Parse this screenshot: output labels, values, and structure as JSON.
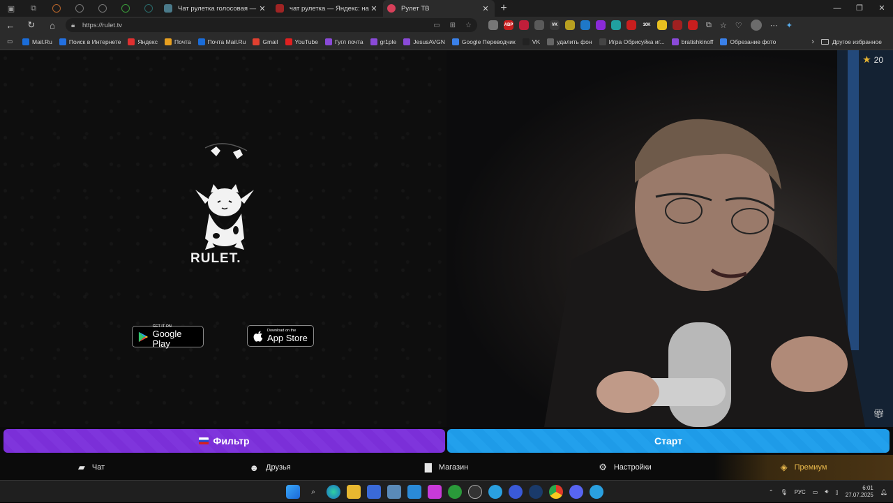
{
  "browser": {
    "tabs": [
      {
        "title": "Чат рулетка голосовая — Nekto",
        "color": "#4a7a8a",
        "active": false
      },
      {
        "title": "чат рулетка — Яндекс: нашлось",
        "color": "#a02424",
        "active": false
      },
      {
        "title": "Рулет ТВ",
        "color": "#d8405a",
        "active": true
      }
    ],
    "close_glyph": "✕",
    "newtab_glyph": "+",
    "url": "https://rulet.tv",
    "bookmarks": [
      {
        "label": "Mail.Ru",
        "color": "#1a6cd8"
      },
      {
        "label": "Поиск в Интернете",
        "color": "#2370e0"
      },
      {
        "label": "Яндекс",
        "color": "#e03030"
      },
      {
        "label": "Почта",
        "color": "#e8a020"
      },
      {
        "label": "Почта Mail.Ru",
        "color": "#1a6cd8"
      },
      {
        "label": "Gmail",
        "color": "#e04030"
      },
      {
        "label": "YouTube",
        "color": "#e02020"
      },
      {
        "label": "Гугл почта",
        "color": "#8a4ad8"
      },
      {
        "label": "gr1ple",
        "color": "#8a4ad8"
      },
      {
        "label": "JesusAVGN",
        "color": "#8a4ad8"
      },
      {
        "label": "Google Переводчик",
        "color": "#3a80e8"
      },
      {
        "label": "VK",
        "color": "#222222"
      },
      {
        "label": "удалить фон",
        "color": "#666666"
      },
      {
        "label": "Игра Обрисуйка иг...",
        "color": "#444444"
      },
      {
        "label": "bratishkinoff",
        "color": "#8a4ad8"
      },
      {
        "label": "Обрезание фото",
        "color": "#3a80e8"
      }
    ],
    "other_bookmarks": "Другое избранное",
    "extensions": [
      {
        "label": "",
        "color": "#777777"
      },
      {
        "label": "ABP",
        "color": "#c81e1e"
      },
      {
        "label": "",
        "color": "#c01e3a"
      },
      {
        "label": "",
        "color": "#5a5a5a"
      },
      {
        "label": "VK",
        "color": "#3a3a3a"
      },
      {
        "label": "",
        "color": "#b8a020"
      },
      {
        "label": "",
        "color": "#1e78c8"
      },
      {
        "label": "",
        "color": "#8a2ad8"
      },
      {
        "label": "",
        "color": "#20a0a0"
      },
      {
        "label": "",
        "color": "#c81e1e"
      },
      {
        "label": "10K",
        "color": "#2a2a2a"
      },
      {
        "label": "",
        "color": "#e8c020"
      },
      {
        "label": "",
        "color": "#a02020"
      },
      {
        "label": "",
        "color": "#c81e1e"
      }
    ]
  },
  "site": {
    "logo_text": "RULET.",
    "google_play": {
      "small": "GET IT ON",
      "big": "Google Play"
    },
    "app_store": {
      "small": "Download on the",
      "big": "App Store"
    },
    "stars_count": "20",
    "filter_label": "Фильтр",
    "start_label": "Старт",
    "menu": {
      "chat": "Чат",
      "friends": "Друзья",
      "shop": "Магазин",
      "settings": "Настройки",
      "premium": "Премиум"
    }
  },
  "taskbar": {
    "language": "РУС",
    "time": "6:01",
    "date": "27.07.2025"
  },
  "colors": {
    "filter_bar": "#7b2fd8",
    "start_bar": "#1e9be8",
    "premium": "#e8b84c",
    "star": "#e8b531"
  }
}
